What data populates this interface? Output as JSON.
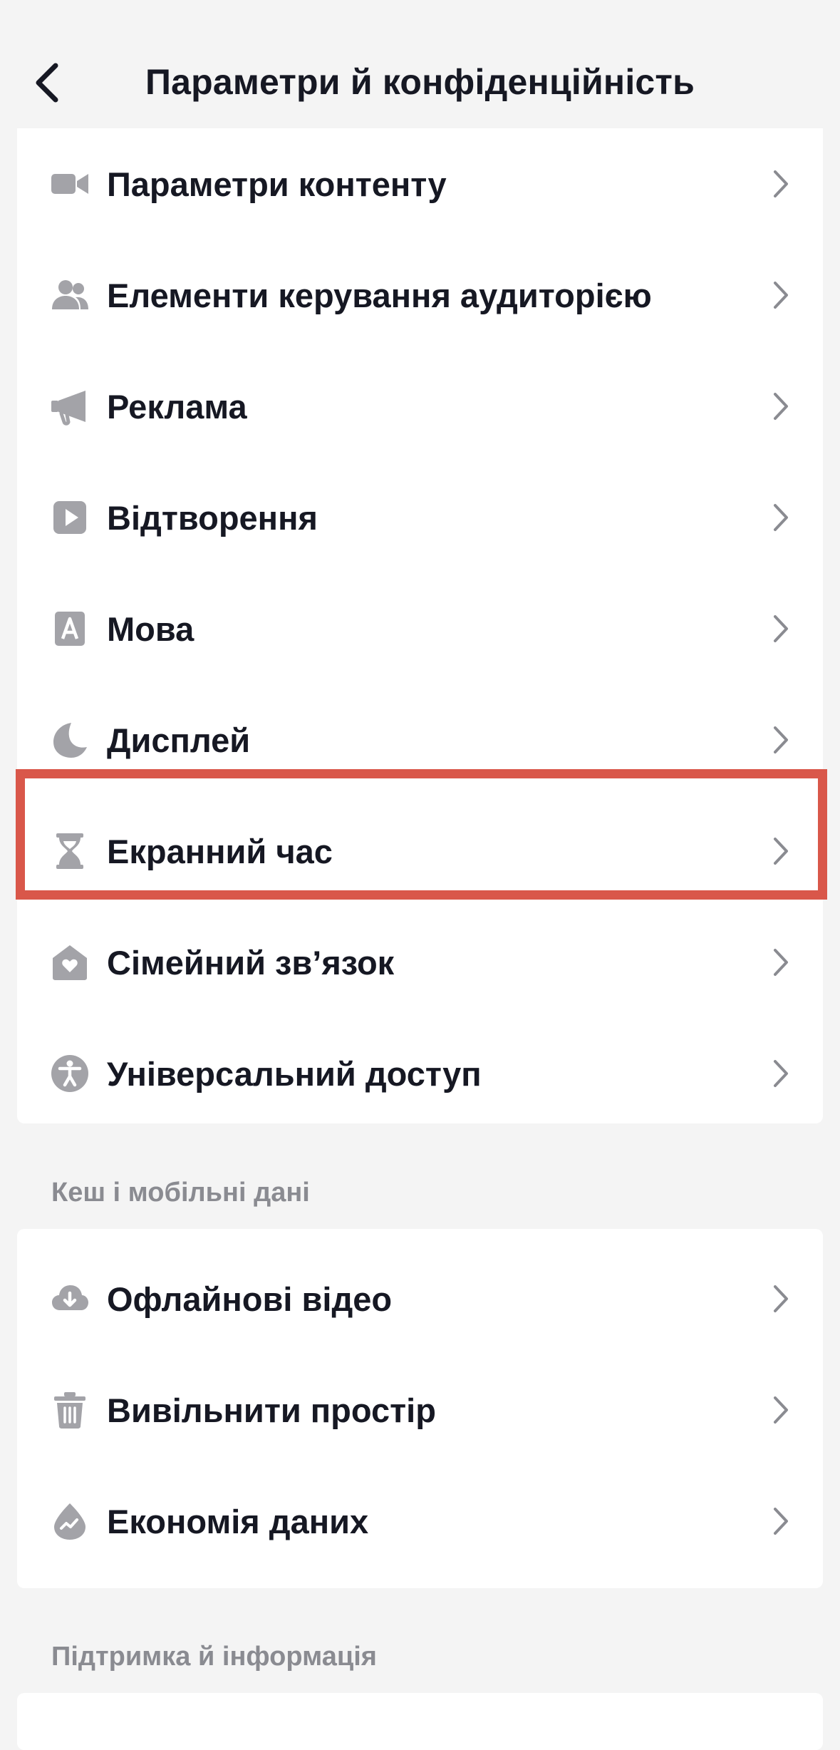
{
  "header": {
    "title": "Параметри й конфіденційність"
  },
  "section1": {
    "items": [
      {
        "label": "Параметри контенту",
        "icon": "video-camera-icon"
      },
      {
        "label": "Елементи керування аудиторією",
        "icon": "people-icon"
      },
      {
        "label": "Реклама",
        "icon": "megaphone-icon"
      },
      {
        "label": "Відтворення",
        "icon": "play-icon"
      },
      {
        "label": "Мова",
        "icon": "language-icon"
      },
      {
        "label": "Дисплей",
        "icon": "moon-icon"
      },
      {
        "label": "Екранний час",
        "icon": "hourglass-icon"
      },
      {
        "label": "Сімейний зв’язок",
        "icon": "family-home-icon"
      },
      {
        "label": "Універсальний доступ",
        "icon": "accessibility-icon"
      }
    ]
  },
  "section2": {
    "header": "Кеш і мобільні дані",
    "items": [
      {
        "label": "Офлайнові відео",
        "icon": "cloud-download-icon"
      },
      {
        "label": "Вивільнити простір",
        "icon": "trash-icon"
      },
      {
        "label": "Економія даних",
        "icon": "data-saver-icon"
      }
    ]
  },
  "section3": {
    "header": "Підтримка й інформація"
  },
  "colors": {
    "background": "#f4f4f4",
    "card": "#ffffff",
    "text": "#161823",
    "icon": "#a3a3a8",
    "section_header": "#8a8b91",
    "highlight": "#d9574a"
  }
}
